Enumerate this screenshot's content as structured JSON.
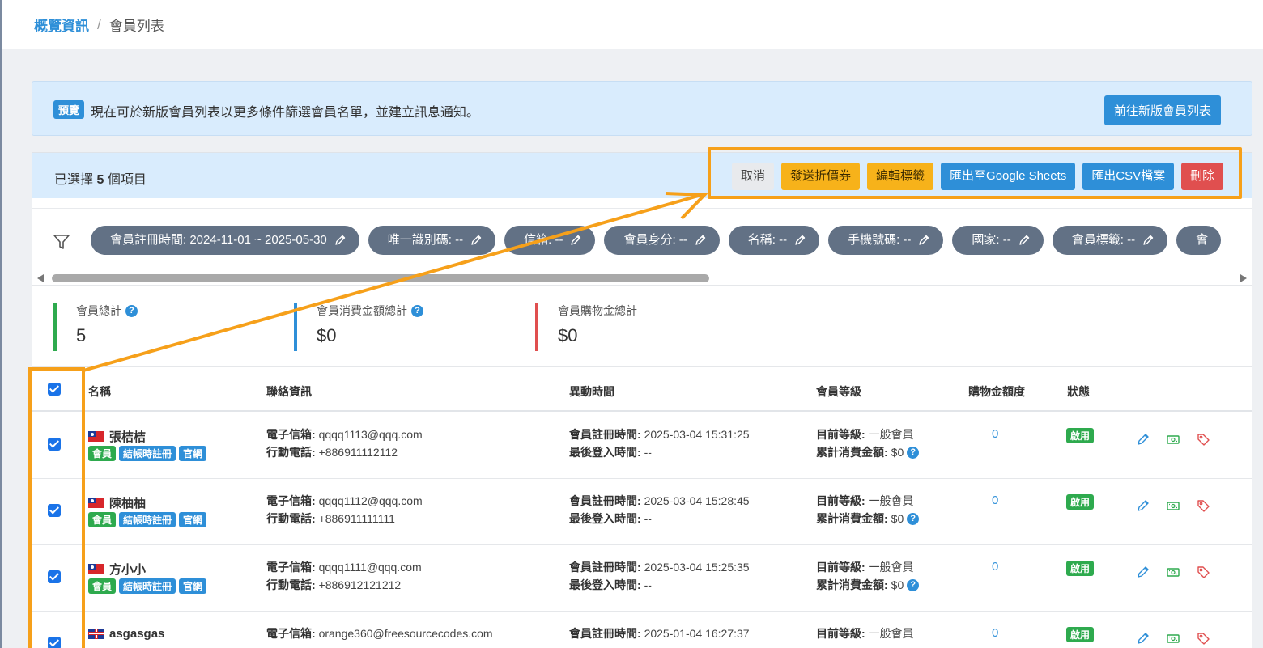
{
  "breadcrumb": {
    "parent": "概覽資訊",
    "separator": "/",
    "current": "會員列表"
  },
  "notice": {
    "badge": "預覽",
    "text": "現在可於新版會員列表以更多條件篩選會員名單，並建立訊息通知。",
    "button": "前往新版會員列表"
  },
  "selection": {
    "prefix": "已選擇",
    "count": "5",
    "suffix": "個項目",
    "actions": {
      "cancel": "取消",
      "send_coupon": "發送折價券",
      "edit_tags": "編輯標籤",
      "export_sheets": "匯出至Google Sheets",
      "export_csv": "匯出CSV檔案",
      "delete": "刪除"
    }
  },
  "filters": [
    "會員註冊時間: 2024-11-01 ~ 2025-05-30",
    "唯一識別碼: --",
    "信箱: --",
    "會員身分: --",
    "名稱: --",
    "手機號碼: --",
    "國家: --",
    "會員標籤: --",
    "會"
  ],
  "stats": [
    {
      "label": "會員總計",
      "value": "5",
      "help": true,
      "color": "#2eaa4e"
    },
    {
      "label": "會員消費金額總計",
      "value": "$0",
      "help": true,
      "color": "#2e8fd8"
    },
    {
      "label": "會員購物金總計",
      "value": "$0",
      "help": false,
      "color": "#e04f4f"
    }
  ],
  "table": {
    "headers": {
      "name": "名稱",
      "contact": "聯絡資訊",
      "activity": "異動時間",
      "level": "會員等級",
      "credit": "購物金額度",
      "status": "狀態"
    },
    "labels": {
      "email": "電子信箱:",
      "phone": "行動電話:",
      "registered": "會員註冊時間:",
      "last_login": "最後登入時間:",
      "current_level": "目前等級:",
      "total_spent": "累計消費金額:"
    },
    "rows": [
      {
        "name": "張桔桔",
        "flag": "tw",
        "tags": [
          "會員",
          "結帳時註冊",
          "官網"
        ],
        "email": "qqqq1113@qqq.com",
        "phone": "+886911112112",
        "registered": "2025-03-04 15:31:25",
        "last_login": "--",
        "level": "一般會員",
        "spent": "$0",
        "credit": "0",
        "status": "啟用"
      },
      {
        "name": "陳柚柚",
        "flag": "tw",
        "tags": [
          "會員",
          "結帳時註冊",
          "官網"
        ],
        "email": "qqqq1112@qqq.com",
        "phone": "+886911111111",
        "registered": "2025-03-04 15:28:45",
        "last_login": "--",
        "level": "一般會員",
        "spent": "$0",
        "credit": "0",
        "status": "啟用"
      },
      {
        "name": "方小小",
        "flag": "tw",
        "tags": [
          "會員",
          "結帳時註冊",
          "官網"
        ],
        "email": "qqqq1111@qqq.com",
        "phone": "+886912121212",
        "registered": "2025-03-04 15:25:35",
        "last_login": "--",
        "level": "一般會員",
        "spent": "$0",
        "credit": "0",
        "status": "啟用"
      },
      {
        "name": "asgasgas",
        "flag": "uk",
        "tags": [],
        "email": "orange360@freesourcecodes.com",
        "phone": "",
        "registered": "2025-01-04 16:27:37",
        "last_login": "",
        "level": "一般會員",
        "spent": "",
        "credit": "0",
        "status": "啟用"
      }
    ]
  },
  "colors": {
    "accent": "#2e8fd8",
    "warning": "#f7b21a",
    "danger": "#e04f4f",
    "success": "#2eaa4e",
    "highlight": "#f6a01a",
    "chip": "#627185"
  }
}
